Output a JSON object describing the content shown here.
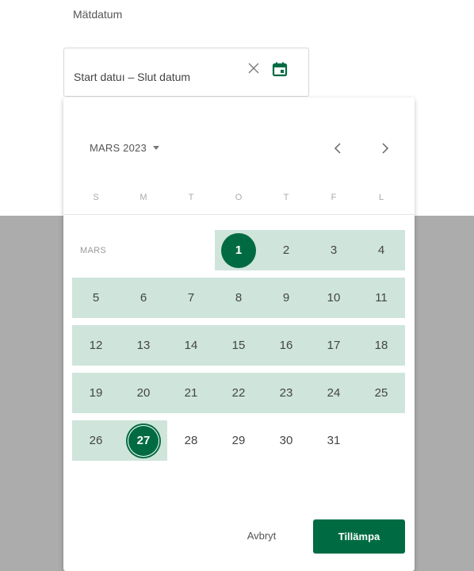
{
  "field": {
    "label": "Mätdatum",
    "range_text": "Start datuı – Slut datum",
    "clear_icon": "close-icon",
    "calendar_icon": "calendar-icon"
  },
  "calendar": {
    "month_label": "MARS 2023",
    "weekdays": [
      "S",
      "M",
      "T",
      "O",
      "T",
      "F",
      "L"
    ],
    "month_tag": "MARS",
    "weeks": [
      [
        "",
        "",
        "",
        "1",
        "2",
        "3",
        "4"
      ],
      [
        "5",
        "6",
        "7",
        "8",
        "9",
        "10",
        "11"
      ],
      [
        "12",
        "13",
        "14",
        "15",
        "16",
        "17",
        "18"
      ],
      [
        "19",
        "20",
        "21",
        "22",
        "23",
        "24",
        "25"
      ],
      [
        "26",
        "27",
        "28",
        "29",
        "30",
        "31",
        ""
      ]
    ],
    "range_start": "1",
    "range_end": "27"
  },
  "actions": {
    "cancel_label": "Avbryt",
    "apply_label": "Tillämpa"
  },
  "colors": {
    "accent": "#006b43",
    "range_band": "#cfe5db",
    "backdrop": "#acacac"
  }
}
